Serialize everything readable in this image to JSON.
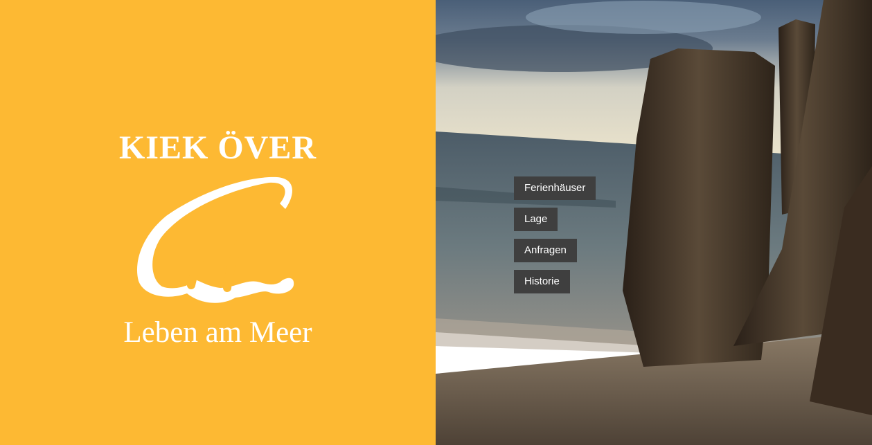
{
  "brand": {
    "title": "KIEK ÖVER",
    "tagline": "Leben am Meer",
    "logo_icon": "wave-logo-icon"
  },
  "nav": {
    "items": [
      {
        "label": "Ferienhäuser"
      },
      {
        "label": "Lage"
      },
      {
        "label": "Anfragen"
      },
      {
        "label": "Historie"
      }
    ]
  },
  "colors": {
    "brand_yellow": "#FDB933",
    "nav_background": "#3F3F3F",
    "text_white": "#FFFFFF"
  }
}
